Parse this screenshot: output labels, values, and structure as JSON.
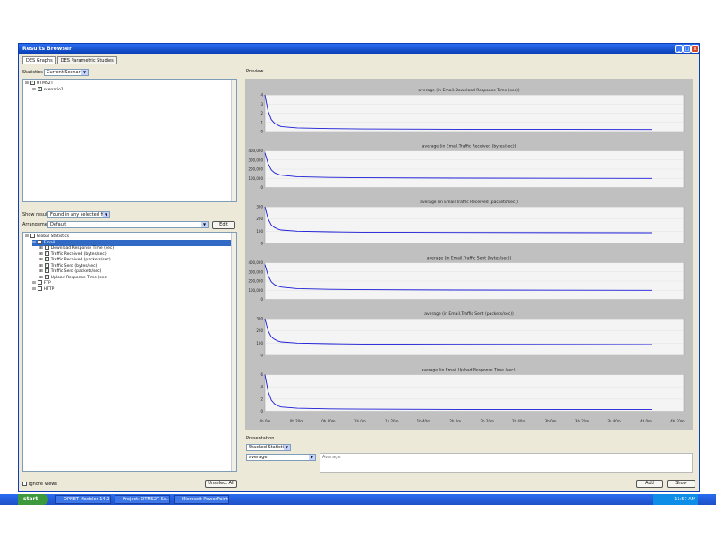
{
  "window": {
    "title": "Results Browser",
    "tabs": [
      "DES Graphs",
      "DES Parametric Studies"
    ]
  },
  "left": {
    "statistics_label": "Statistics",
    "statistics_value": "Current Scenario",
    "scenario_tree": [
      {
        "label": "OTMS2T",
        "checked": true,
        "level": 0
      },
      {
        "label": "scenario1",
        "checked": true,
        "level": 1
      }
    ],
    "show_results_label": "Show results",
    "show_results_value": "Found in any selected files",
    "arrangement_label": "Arrangement",
    "arrangement_value": "Default",
    "edit_label": "Edit",
    "stats_tree": [
      {
        "label": "Global Statistics",
        "checked": false,
        "level": 0,
        "selected": false
      },
      {
        "label": "Email",
        "checked": false,
        "level": 1,
        "selected": true
      },
      {
        "label": "Download Response Time (sec)",
        "checked": false,
        "level": 2,
        "selected": false
      },
      {
        "label": "Traffic Received (bytes/sec)",
        "checked": true,
        "level": 2,
        "selected": false
      },
      {
        "label": "Traffic Received (packets/sec)",
        "checked": true,
        "level": 2,
        "selected": false
      },
      {
        "label": "Traffic Sent (bytes/sec)",
        "checked": true,
        "level": 2,
        "selected": false
      },
      {
        "label": "Traffic Sent (packets/sec)",
        "checked": true,
        "level": 2,
        "selected": false
      },
      {
        "label": "Upload Response Time (sec)",
        "checked": true,
        "level": 2,
        "selected": false
      },
      {
        "label": "FTP",
        "checked": false,
        "level": 1,
        "selected": false
      },
      {
        "label": "HTTP",
        "checked": false,
        "level": 1,
        "selected": false
      }
    ],
    "ignore_views_label": "Ignore Views",
    "unselect_all_label": "Unselect All"
  },
  "preview": {
    "label": "Preview"
  },
  "presentation": {
    "label": "Presentation",
    "mode_value": "Stacked Statistics",
    "filter_value": "average",
    "list_header_label": "Average",
    "add_label": "Add",
    "show_label": "Show"
  },
  "chart_data": [
    {
      "type": "line",
      "title": "average (in Email.Download Response Time (sec))",
      "yticks": [
        "0",
        "1",
        "2",
        "3",
        "4"
      ],
      "x": [
        0,
        2,
        4,
        6,
        8,
        10,
        20,
        40,
        60,
        120,
        240
      ],
      "values": [
        4.0,
        2.2,
        1.3,
        0.9,
        0.7,
        0.55,
        0.4,
        0.32,
        0.28,
        0.25,
        0.22
      ]
    },
    {
      "type": "line",
      "title": "average (in Email.Traffic Received (bytes/sec))",
      "yticks": [
        "0",
        "100,000",
        "200,000",
        "300,000",
        "400,000"
      ],
      "x": [
        0,
        2,
        4,
        6,
        8,
        10,
        20,
        40,
        60,
        120,
        240
      ],
      "values": [
        380000,
        260000,
        190000,
        160000,
        145000,
        135000,
        118000,
        110000,
        106000,
        102000,
        100000
      ]
    },
    {
      "type": "line",
      "title": "average (in Email.Traffic Received (packets/sec))",
      "yticks": [
        "0",
        "100",
        "200",
        "300"
      ],
      "x": [
        0,
        2,
        4,
        6,
        8,
        10,
        20,
        40,
        60,
        120,
        240
      ],
      "values": [
        300,
        200,
        150,
        130,
        118,
        110,
        100,
        95,
        92,
        90,
        88
      ]
    },
    {
      "type": "line",
      "title": "average (in Email.Traffic Sent (bytes/sec))",
      "yticks": [
        "0",
        "100,000",
        "200,000",
        "300,000",
        "400,000"
      ],
      "x": [
        0,
        2,
        4,
        6,
        8,
        10,
        20,
        40,
        60,
        120,
        240
      ],
      "values": [
        380000,
        260000,
        190000,
        160000,
        145000,
        135000,
        118000,
        110000,
        106000,
        102000,
        100000
      ]
    },
    {
      "type": "line",
      "title": "average (in Email.Traffic Sent (packets/sec))",
      "yticks": [
        "0",
        "100",
        "200",
        "300"
      ],
      "x": [
        0,
        2,
        4,
        6,
        8,
        10,
        20,
        40,
        60,
        120,
        240
      ],
      "values": [
        300,
        200,
        150,
        130,
        118,
        110,
        100,
        95,
        92,
        90,
        88
      ]
    },
    {
      "type": "line",
      "title": "average (in Email.Upload Response Time (sec))",
      "yticks": [
        "0",
        "2",
        "4",
        "6"
      ],
      "x": [
        0,
        2,
        4,
        6,
        8,
        10,
        20,
        40,
        60,
        120,
        240
      ],
      "values": [
        6.0,
        3.2,
        1.8,
        1.2,
        0.9,
        0.7,
        0.5,
        0.4,
        0.35,
        0.3,
        0.28
      ]
    }
  ],
  "time_axis": [
    "0h 0m",
    "0h 20m",
    "0h 40m",
    "1h 0m",
    "1h 20m",
    "1h 40m",
    "2h 0m",
    "2h 20m",
    "2h 40m",
    "3h 0m",
    "3h 20m",
    "3h 40m",
    "4h 0m",
    "4h 20m"
  ],
  "taskbar": {
    "start_label": "start",
    "items": [
      "OPNET Modeler 14.0",
      "Project: OTMS2T Sc...",
      "Microsoft PowerPoint -..."
    ],
    "clock": "11:57 AM"
  }
}
